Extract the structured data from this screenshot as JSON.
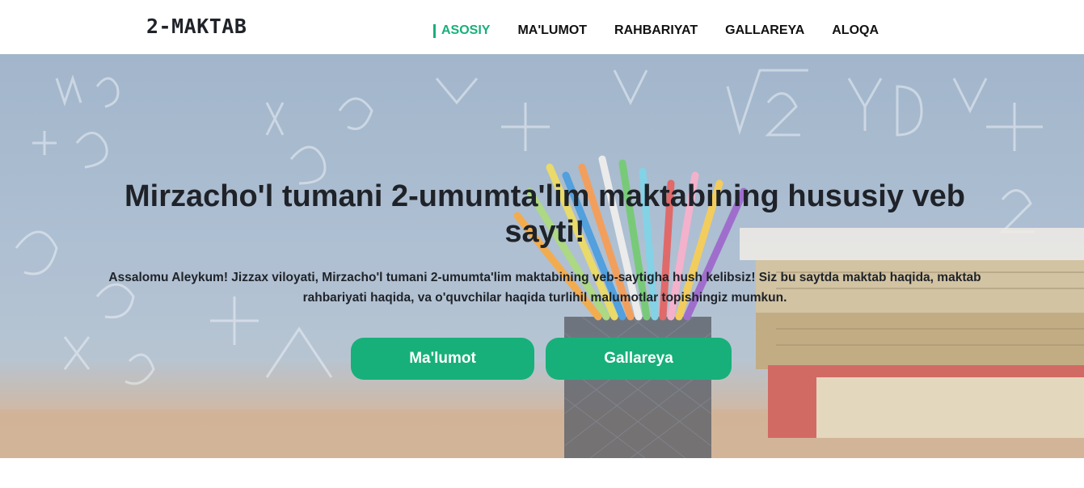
{
  "navbar": {
    "brand": "2-MAKTAB",
    "links": [
      {
        "label": "ASOSIY",
        "active": true
      },
      {
        "label": "MA'LUMOT",
        "active": false
      },
      {
        "label": "RAHBARIYAT",
        "active": false
      },
      {
        "label": "GALLAREYA",
        "active": false
      },
      {
        "label": "ALOQA",
        "active": false
      }
    ]
  },
  "hero": {
    "title": "Mirzacho'l tumani 2-umumta'lim maktabining hususiy veb sayti!",
    "text": "Assalomu Aleykum! Jizzax viloyati, Mirzacho'l tumani 2-umumta'lim maktabining veb-saytigha hush kelibsiz! Siz bu saytda maktab haqida, maktab rahbariyati haqida, va o'quvchilar haqida turlihil malumotlar topishingiz mumkun.",
    "buttons": {
      "info": "Ma'lumot",
      "gallery": "Gallareya"
    }
  },
  "colors": {
    "accent": "#17b07a",
    "text_dark": "#1f2329"
  }
}
